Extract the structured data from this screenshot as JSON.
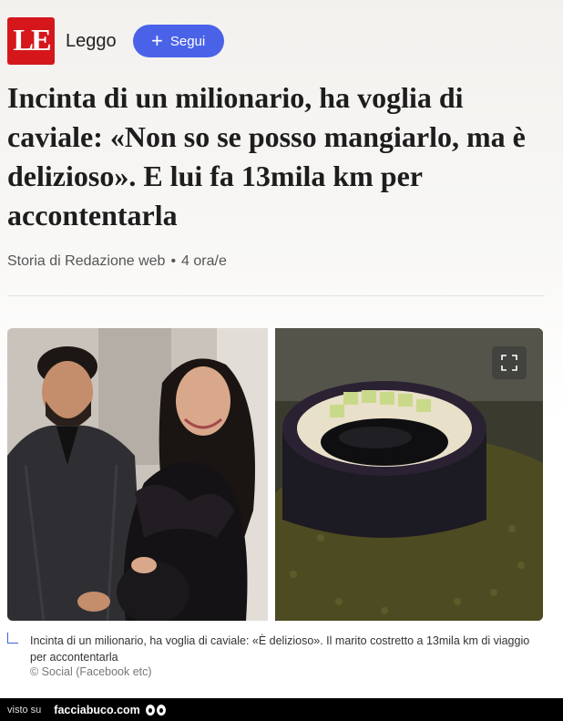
{
  "header": {
    "logo_text": "LE",
    "source_name": "Leggo",
    "follow_label": "Segui",
    "follow_icon": "plus-icon"
  },
  "article": {
    "headline": "Incinta di un milionario, ha voglia di caviale: «Non so se posso mangiarlo, ma è delizioso». E lui fa 13mila km per accontentarla",
    "byline": "Storia di Redazione web",
    "time": "4 ora/e"
  },
  "gallery": {
    "left_photo": "couple-photo",
    "right_photo": "caviar-dish-photo",
    "expand_icon": "expand-icon"
  },
  "caption": {
    "text": "Incinta di un milionario, ha voglia di caviale: «È delizioso». Il marito costretto a 13mila km di viaggio per accontentarla",
    "credit": "© Social (Facebook etc)"
  },
  "footer": {
    "visto_su": "visto su",
    "site": "facciabuco.com"
  },
  "colors": {
    "logo_red": "#d5171b",
    "follow_blue": "#4a62e8",
    "footer_bg": "#000000"
  }
}
